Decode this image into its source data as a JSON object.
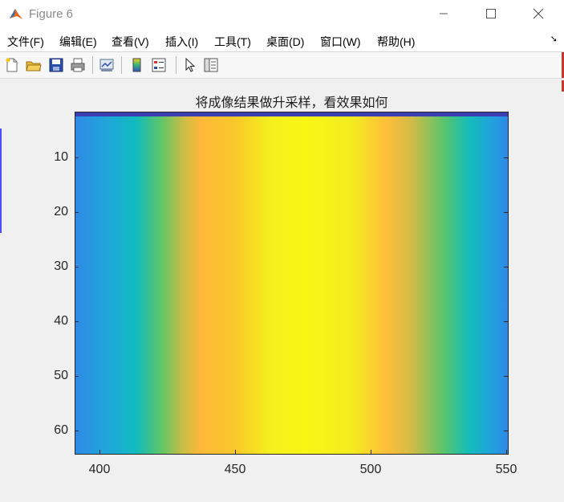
{
  "window": {
    "title": "Figure 6"
  },
  "menu": [
    "文件(F)",
    "编辑(E)",
    "查看(V)",
    "插入(I)",
    "工具(T)",
    "桌面(D)",
    "窗口(W)",
    "帮助(H)"
  ],
  "toolbar": {
    "icons": [
      "new-figure-icon",
      "open-file-icon",
      "save-icon",
      "print-icon",
      "link-plot-icon",
      "insert-colorbar-icon",
      "insert-legend-icon",
      "edit-plot-pointer-icon",
      "property-inspector-icon"
    ]
  },
  "plot": {
    "title": "将成像结果做升采样，看效果如何",
    "yticks": [
      "10",
      "20",
      "30",
      "40",
      "50",
      "60"
    ],
    "xticks": [
      "400",
      "450",
      "500",
      "550"
    ]
  },
  "colors": {
    "colormap": "parula",
    "axes_border": "#262626"
  }
}
